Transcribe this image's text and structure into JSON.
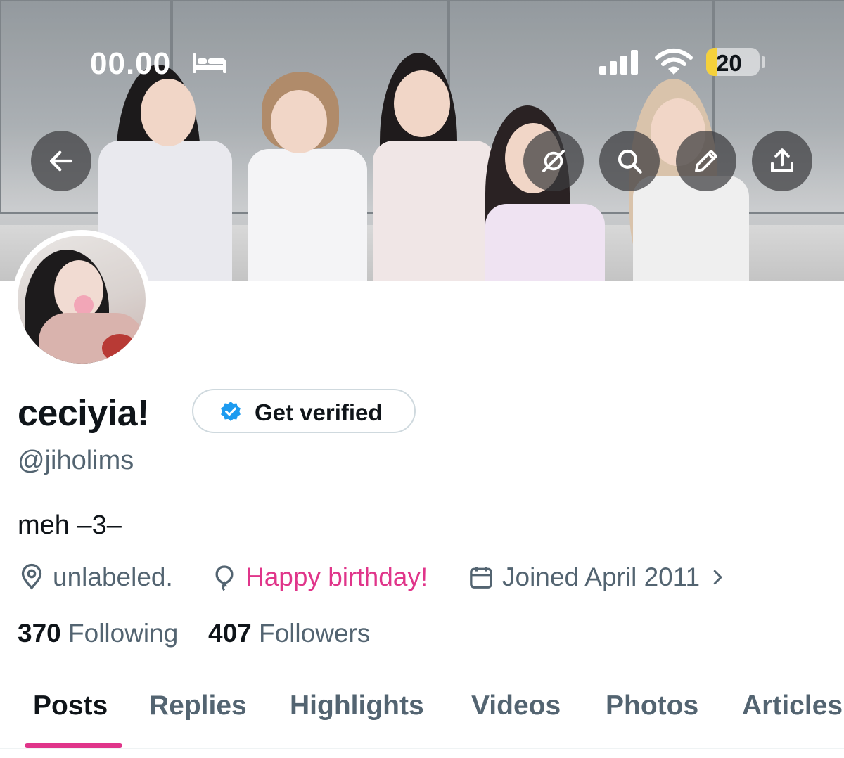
{
  "status_bar": {
    "time": "00.00",
    "battery_level": "20",
    "sleep_icon": "bed-icon",
    "signal_icon": "cellular-signal-icon",
    "wifi_icon": "wifi-icon"
  },
  "header_actions": {
    "back_icon": "arrow-left-icon",
    "grok_icon": "grok-icon",
    "search_icon": "search-icon",
    "edit_icon": "pencil-icon",
    "share_icon": "share-icon"
  },
  "profile": {
    "display_name": "ceciyia!",
    "get_verified_label": "Get verified",
    "handle": "@jiholims",
    "bio": "meh –3–",
    "location": "unlabeled.",
    "birthday": "Happy birthday!",
    "joined": "Joined April 2011",
    "following_count": "370",
    "following_label": "Following",
    "followers_count": "407",
    "followers_label": "Followers"
  },
  "tabs": [
    {
      "label": "Posts",
      "active": true
    },
    {
      "label": "Replies",
      "active": false
    },
    {
      "label": "Highlights",
      "active": false
    },
    {
      "label": "Videos",
      "active": false
    },
    {
      "label": "Photos",
      "active": false
    },
    {
      "label": "Articles",
      "active": false
    }
  ],
  "colors": {
    "accent": "#e0358a",
    "verified_blue": "#1d9bf0",
    "text_primary": "#0f1419",
    "text_secondary": "#536471"
  }
}
